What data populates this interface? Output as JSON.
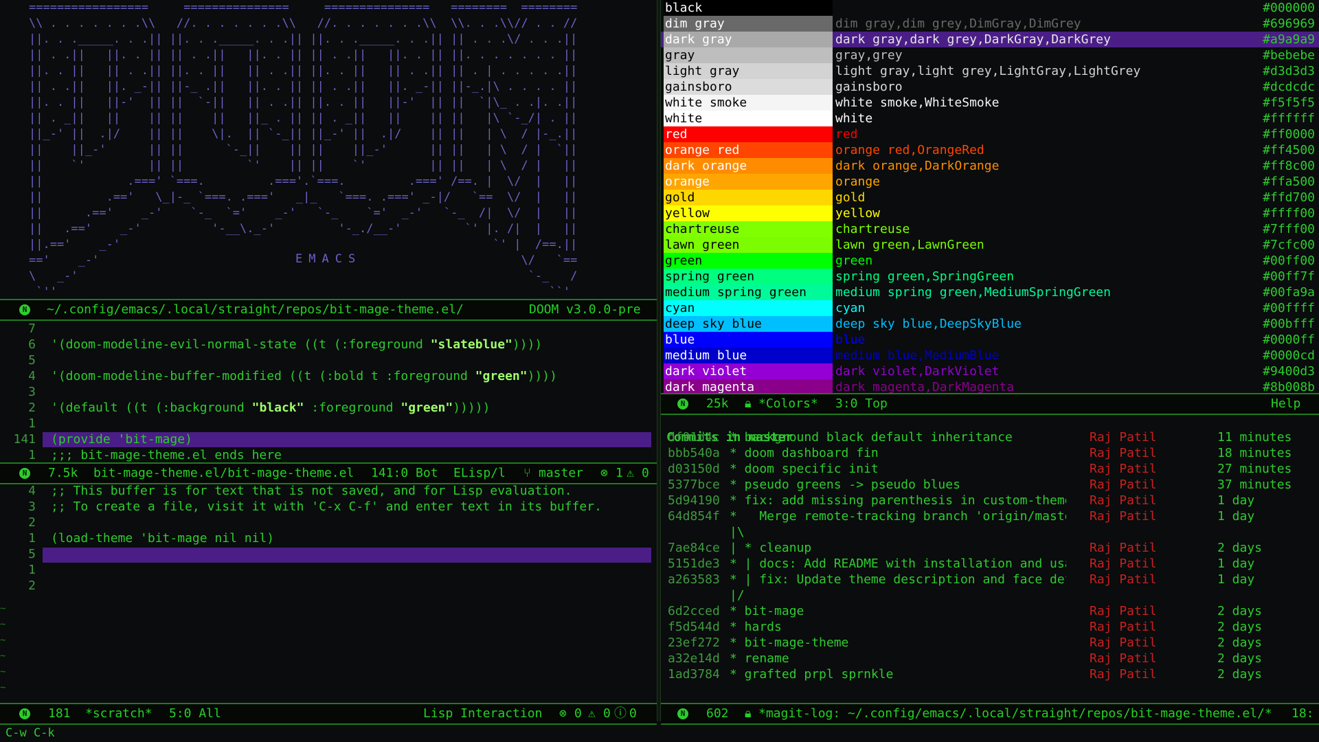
{
  "ascii_banner": [
    "=================     ===============     ===============   ========  ========",
    "\\\\ . . . . . . .\\\\   //. . . . . . .\\\\   //. . . . . . .\\\\  \\\\. . .\\\\// . . //",
    "||. . ._____. . .|| ||. . ._____. . .|| ||. . ._____. . .|| || . . .\\/ . . .||",
    "|| . .||   ||. . || || . .||   ||. . || || . .||   ||. . || ||. . . . . . . ||",
    "||. . ||   || . .|| ||. . ||   || . .|| ||. . ||   || . .|| || . | . . . . .||",
    "|| . .||   ||. _-|| ||-_ .||   ||. . || || . .||   ||. _-|| ||-_.|\\ . . . . ||",
    "||. . ||   ||-'  || ||  `-||   || . .|| ||. . ||   ||-'  || ||  `|\\_ . .|. .||",
    "|| . _||   ||    || ||    ||   ||_ . || || . _||   ||    || ||   |\\ `-_/| . ||",
    "||_-' ||  .|/    || ||    \\|.  || `-_|| ||_-' ||  .|/    || ||   | \\  / |-_.||",
    "||    ||_-'      || ||      `-_||    || ||    ||_-'      || ||   | \\  / |  `||",
    "||    `'         || ||         `'    || ||    `'         || ||   | \\  / |   ||",
    "||            .===' `===.         .==='.`===.         .===' /==. |  \\/  |   ||",
    "||         .=='   \\_|-_ `===. .==='   _|_   `===. .===' _-|/   `==  \\/  |   ||",
    "||      .=='    _-'    `-_  `='    _-'   `-_    `='  _-'   `-_  /|  \\/  |   ||",
    "||   .=='    _-'          '-__\\._-'         '-_./__-'         `' |. /|  |   ||",
    "||.=='    _-'                                                     `' |  /==.||",
    "=='    _-'                                                            \\/   `==",
    "\\   _-'                                                                `-_   /",
    " `''                                                                      ``'"
  ],
  "emacs_label": "EMACS",
  "top_left_modeline": {
    "path": "~/.config/emacs/.local/straight/repos/bit-mage-theme.el/",
    "version": "DOOM v3.0.0-pre"
  },
  "editor": {
    "lines": [
      {
        "num": "7",
        "text": ""
      },
      {
        "num": "6",
        "text": "'(doom-modeline-evil-normal-state ((t (:foreground \"slateblue\"))))"
      },
      {
        "num": "5",
        "text": ""
      },
      {
        "num": "4",
        "text": "'(doom-modeline-buffer-modified ((t (:bold t :foreground \"green\"))))"
      },
      {
        "num": "3",
        "text": ""
      },
      {
        "num": "2",
        "text": "'(default ((t (:background \"black\" :foreground \"green\")))))"
      },
      {
        "num": "1",
        "text": ""
      },
      {
        "num": "141",
        "text": "(provide 'bit-mage)"
      },
      {
        "num": "1",
        "text": ";;; bit-mage-theme.el ends here"
      }
    ],
    "modeline": {
      "size": "7.5k",
      "file": "bit-mage-theme.el/bit-mage-theme.el",
      "pos": "141:0 Bot",
      "mode": "ELisp/l",
      "branch": "master",
      "errors": "1",
      "warnings": "0"
    }
  },
  "scratch": {
    "lines": [
      {
        "num": "4",
        "text": ";; This buffer is for text that is not saved, and for Lisp evaluation."
      },
      {
        "num": "3",
        "text": ";; To create a file, visit it with 'C-x C-f' and enter text in its buffer."
      },
      {
        "num": "2",
        "text": ""
      },
      {
        "num": "1",
        "text": "(load-theme 'bit-mage nil nil)"
      },
      {
        "num": "5",
        "text": ""
      },
      {
        "num": "1",
        "text": ""
      },
      {
        "num": "2",
        "text": ""
      }
    ],
    "modeline": {
      "size": "181",
      "name": "*scratch*",
      "pos": "5:0 All",
      "mode": "Lisp Interaction",
      "errors": "0",
      "warnings": "0",
      "info": "0"
    }
  },
  "colors": {
    "rows": [
      {
        "name": "black",
        "aliases": "",
        "hex": "#000000",
        "swatch": "#000000",
        "fg": "#ffffff",
        "alias_color": "#000000"
      },
      {
        "name": "dim gray",
        "aliases": "dim gray,dim grey,DimGray,DimGrey",
        "hex": "#696969",
        "swatch": "#696969",
        "fg": "#ffffff",
        "alias_color": "#696969"
      },
      {
        "name": "dark gray",
        "aliases": "dark gray,dark grey,DarkGray,DarkGrey",
        "hex": "#a9a9a9",
        "swatch": "#a9a9a9",
        "fg": "#ffffff",
        "alias_color": "#a9a9a9"
      },
      {
        "name": "gray",
        "aliases": "gray,grey",
        "hex": "#bebebe",
        "swatch": "#bebebe",
        "fg": "#000000",
        "alias_color": "#bebebe"
      },
      {
        "name": "light gray",
        "aliases": "light gray,light grey,LightGray,LightGrey",
        "hex": "#d3d3d3",
        "swatch": "#d3d3d3",
        "fg": "#000000",
        "alias_color": "#d3d3d3"
      },
      {
        "name": "gainsboro",
        "aliases": "gainsboro",
        "hex": "#dcdcdc",
        "swatch": "#dcdcdc",
        "fg": "#000000",
        "alias_color": "#dcdcdc"
      },
      {
        "name": "white smoke",
        "aliases": "white smoke,WhiteSmoke",
        "hex": "#f5f5f5",
        "swatch": "#f5f5f5",
        "fg": "#000000",
        "alias_color": "#f5f5f5"
      },
      {
        "name": "white",
        "aliases": "white",
        "hex": "#ffffff",
        "swatch": "#ffffff",
        "fg": "#000000",
        "alias_color": "#ffffff"
      },
      {
        "name": "red",
        "aliases": "red",
        "hex": "#ff0000",
        "swatch": "#ff0000",
        "fg": "#ffffff",
        "alias_color": "#ff0000"
      },
      {
        "name": "orange red",
        "aliases": "orange red,OrangeRed",
        "hex": "#ff4500",
        "swatch": "#ff4500",
        "fg": "#ffffff",
        "alias_color": "#ff4500"
      },
      {
        "name": "dark orange",
        "aliases": "dark orange,DarkOrange",
        "hex": "#ff8c00",
        "swatch": "#ff8c00",
        "fg": "#ffffff",
        "alias_color": "#ff8c00"
      },
      {
        "name": "orange",
        "aliases": "orange",
        "hex": "#ffa500",
        "swatch": "#ffa500",
        "fg": "#ffffff",
        "alias_color": "#ffa500"
      },
      {
        "name": "gold",
        "aliases": "gold",
        "hex": "#ffd700",
        "swatch": "#ffd700",
        "fg": "#000000",
        "alias_color": "#ffd700"
      },
      {
        "name": "yellow",
        "aliases": "yellow",
        "hex": "#ffff00",
        "swatch": "#ffff00",
        "fg": "#000000",
        "alias_color": "#ffff00"
      },
      {
        "name": "chartreuse",
        "aliases": "chartreuse",
        "hex": "#7fff00",
        "swatch": "#7fff00",
        "fg": "#000000",
        "alias_color": "#7fff00"
      },
      {
        "name": "lawn green",
        "aliases": "lawn green,LawnGreen",
        "hex": "#7cfc00",
        "swatch": "#7cfc00",
        "fg": "#000000",
        "alias_color": "#7cfc00"
      },
      {
        "name": "green",
        "aliases": "green",
        "hex": "#00ff00",
        "swatch": "#00ff00",
        "fg": "#000000",
        "alias_color": "#00ff00"
      },
      {
        "name": "spring green",
        "aliases": "spring green,SpringGreen",
        "hex": "#00ff7f",
        "swatch": "#00ff7f",
        "fg": "#000000",
        "alias_color": "#00ff7f"
      },
      {
        "name": "medium spring green",
        "aliases": "medium spring green,MediumSpringGreen",
        "hex": "#00fa9a",
        "swatch": "#00fa9a",
        "fg": "#000000",
        "alias_color": "#00fa9a"
      },
      {
        "name": "cyan",
        "aliases": "cyan",
        "hex": "#00ffff",
        "swatch": "#00ffff",
        "fg": "#000000",
        "alias_color": "#00ffff"
      },
      {
        "name": "deep sky blue",
        "aliases": "deep sky blue,DeepSkyBlue",
        "hex": "#00bfff",
        "swatch": "#00bfff",
        "fg": "#000000",
        "alias_color": "#00bfff"
      },
      {
        "name": "blue",
        "aliases": "blue",
        "hex": "#0000ff",
        "swatch": "#0000ff",
        "fg": "#ffffff",
        "alias_color": "#0000ff"
      },
      {
        "name": "medium blue",
        "aliases": "medium blue,MediumBlue",
        "hex": "#0000cd",
        "swatch": "#0000cd",
        "fg": "#ffffff",
        "alias_color": "#0000cd"
      },
      {
        "name": "dark violet",
        "aliases": "dark violet,DarkViolet",
        "hex": "#9400d3",
        "swatch": "#9400d3",
        "fg": "#ffffff",
        "alias_color": "#9400d3"
      },
      {
        "name": "dark magenta",
        "aliases": "dark magenta,DarkMagenta",
        "hex": "#8b008b",
        "swatch": "#8b008b",
        "fg": "#ffffff",
        "alias_color": "#8b008b"
      }
    ],
    "modeline": {
      "size": "25k",
      "name": "*Colors*",
      "pos": "3:0 Top",
      "mode": "Help"
    }
  },
  "magit": {
    "heading": "Commits in master",
    "commits": [
      {
        "sha": "df91d4c",
        "msg": "* background black default inheritance",
        "author": "Raj Patil",
        "age": "11 minutes"
      },
      {
        "sha": "bbb540a",
        "msg": "* doom dashboard fin",
        "author": "Raj Patil",
        "age": "18 minutes"
      },
      {
        "sha": "d03150d",
        "msg": "* doom specific init",
        "author": "Raj Patil",
        "age": "27 minutes"
      },
      {
        "sha": "5377bce",
        "msg": "* pseudo greens -> pseudo blues",
        "author": "Raj Patil",
        "age": "37 minutes"
      },
      {
        "sha": "5d94190",
        "msg": "* fix: add missing parenthesis in custom-theme-se",
        "author": "Raj Patil",
        "age": "1 day"
      },
      {
        "sha": "64d854f",
        "msg": "*   Merge remote-tracking branch 'origin/master'",
        "author": "Raj Patil",
        "age": "1 day"
      },
      {
        "sha": "",
        "msg": "|\\",
        "author": "",
        "age": ""
      },
      {
        "sha": "7ae84ce",
        "msg": "| * cleanup",
        "author": "Raj Patil",
        "age": "2 days"
      },
      {
        "sha": "5151de3",
        "msg": "* | docs: Add README with installation and usage",
        "author": "Raj Patil",
        "age": "1 day"
      },
      {
        "sha": "a263583",
        "msg": "* | fix: Update theme description and face defin",
        "author": "Raj Patil",
        "age": "1 day"
      },
      {
        "sha": "",
        "msg": "|/",
        "author": "",
        "age": ""
      },
      {
        "sha": "6d2cced",
        "msg": "* bit-mage",
        "author": "Raj Patil",
        "age": "2 days"
      },
      {
        "sha": "f5d544d",
        "msg": "* hards",
        "author": "Raj Patil",
        "age": "2 days"
      },
      {
        "sha": "23ef272",
        "msg": "* bit-mage-theme",
        "author": "Raj Patil",
        "age": "2 days"
      },
      {
        "sha": "a32e14d",
        "msg": "* rename",
        "author": "Raj Patil",
        "age": "2 days"
      },
      {
        "sha": "1ad3784",
        "msg": "* grafted prpl sprnkle",
        "author": "Raj Patil",
        "age": "2 days"
      }
    ],
    "modeline": {
      "size": "602",
      "name": "*magit-log: ~/.config/emacs/.local/straight/repos/bit-mage-theme.el/*",
      "pos": "18:"
    }
  },
  "minibuffer": "C-w C-k",
  "modeline_badge": "N"
}
